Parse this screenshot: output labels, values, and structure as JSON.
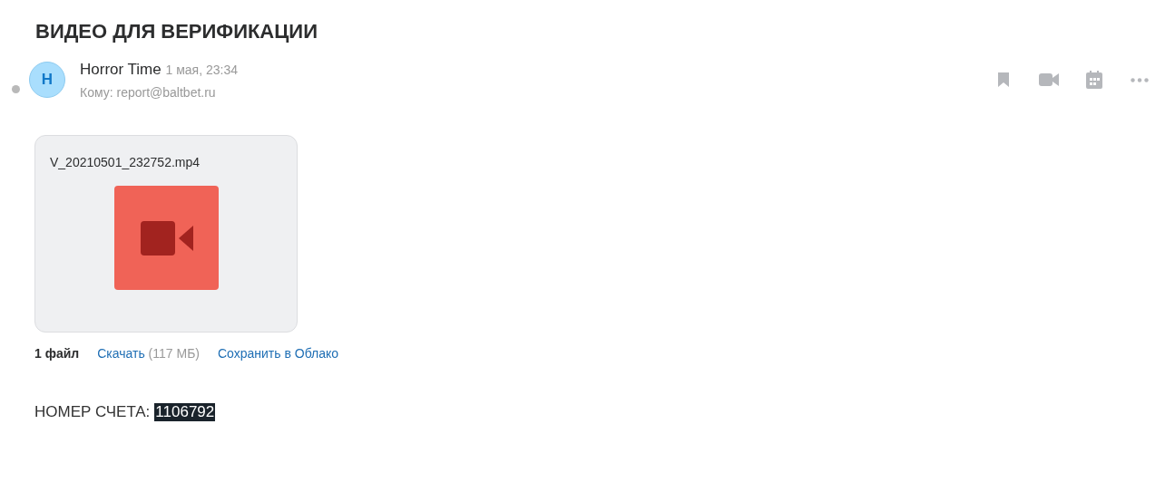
{
  "subject": "ВИДЕО ДЛЯ ВЕРИФИКАЦИИ",
  "message": {
    "unread": true,
    "avatar_letter": "H",
    "sender": "Horror Time",
    "date": "1 мая, 23:34",
    "recipient": "Кому: report@baltbet.ru"
  },
  "actions": [
    {
      "kind": "bookmark"
    },
    {
      "kind": "video"
    },
    {
      "kind": "calendar"
    },
    {
      "kind": "more"
    }
  ],
  "attachment": {
    "filename": "V_20210501_232752.mp4",
    "kind": "video"
  },
  "attachments_bar": {
    "count": "1 файл",
    "download": "Скачать",
    "size": "(117 МБ)",
    "save": "Сохранить в Облако"
  },
  "body": {
    "label": "НОМЕР СЧЕТА:",
    "value": "1106792",
    "highlighted": true
  }
}
